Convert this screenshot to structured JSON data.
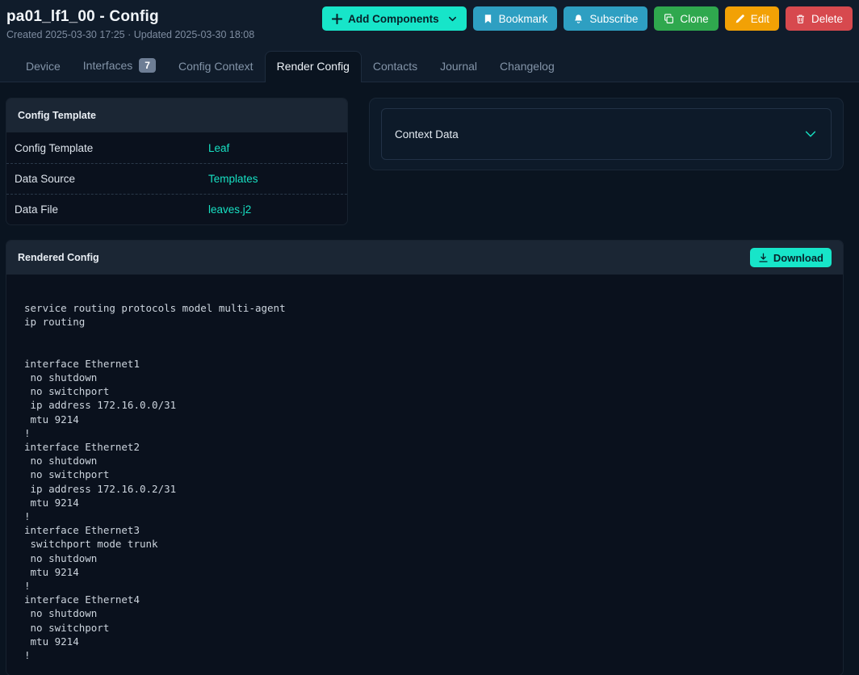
{
  "page": {
    "title": "pa01_lf1_00 - Config",
    "subtitle": "Created 2025-03-30 17:25 · Updated 2025-03-30 18:08"
  },
  "toolbar": {
    "add_components_label": "Add Components",
    "bookmark_label": "Bookmark",
    "subscribe_label": "Subscribe",
    "clone_label": "Clone",
    "edit_label": "Edit",
    "delete_label": "Delete"
  },
  "tabs": [
    {
      "label": "Device",
      "active": false
    },
    {
      "label": "Interfaces",
      "badge": "7",
      "active": false
    },
    {
      "label": "Config Context",
      "active": false
    },
    {
      "label": "Render Config",
      "active": true
    },
    {
      "label": "Contacts",
      "active": false
    },
    {
      "label": "Journal",
      "active": false
    },
    {
      "label": "Changelog",
      "active": false
    }
  ],
  "config_template_card": {
    "title": "Config Template",
    "rows": [
      {
        "label": "Config Template",
        "value": "Leaf"
      },
      {
        "label": "Data Source",
        "value": "Templates"
      },
      {
        "label": "Data File",
        "value": "leaves.j2"
      }
    ]
  },
  "context_data_card": {
    "title": "Context Data"
  },
  "rendered_config_card": {
    "title": "Rendered Config",
    "download_label": "Download",
    "content": "service routing protocols model multi-agent\nip routing\n\n\ninterface Ethernet1\n no shutdown\n no switchport\n ip address 172.16.0.0/31\n mtu 9214\n!\ninterface Ethernet2\n no shutdown\n no switchport\n ip address 172.16.0.2/31\n mtu 9214\n!\ninterface Ethernet3\n switchport mode trunk\n no shutdown\n mtu 9214\n!\ninterface Ethernet4\n no shutdown\n no switchport\n mtu 9214\n!"
  },
  "colors": {
    "accent_teal": "#17e5c9",
    "link_teal": "#17e1c3",
    "info_blue": "#2e9fc2",
    "success_green": "#2fa84e",
    "warning_yellow": "#f2a105",
    "danger_red": "#d7494e",
    "header_background": "#101c2b",
    "content_background": "#0a1420",
    "card_header_background": "#1b2634"
  }
}
